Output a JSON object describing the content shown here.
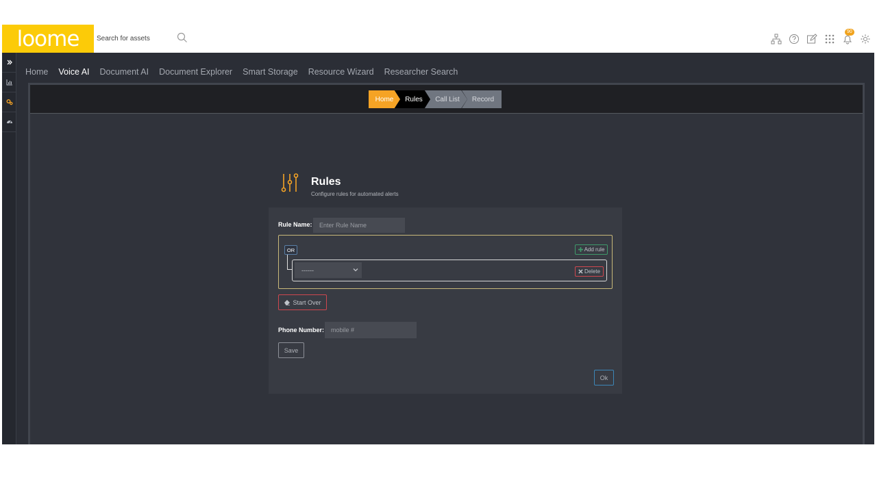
{
  "header": {
    "logo_text": "loome",
    "search_placeholder": "Search for assets",
    "notification_count": "90",
    "icons": [
      "sitemap-icon",
      "help-icon",
      "edit-icon",
      "apps-grid-icon",
      "bell-icon",
      "gear-icon"
    ]
  },
  "sidebar": {
    "items": [
      "expand-icon",
      "chart-icon",
      "cogs-icon",
      "dashboard-icon"
    ]
  },
  "nav": {
    "items": [
      "Home",
      "Voice AI",
      "Document AI",
      "Document Explorer",
      "Smart Storage",
      "Resource Wizard",
      "Researcher Search"
    ],
    "active": "Voice AI"
  },
  "breadcrumb": [
    "Home",
    "Rules",
    "Call List",
    "Record"
  ],
  "rules": {
    "title": "Rules",
    "subtitle": "Configure rules for automated alerts",
    "rule_name_label": "Rule Name:",
    "rule_name_placeholder": "Enter Rule Name",
    "or_label": "OR",
    "add_rule_label": "Add rule",
    "select_value": "------",
    "delete_label": "Delete",
    "start_over_label": "Start Over",
    "phone_label": "Phone Number:",
    "phone_placeholder": "mobile #",
    "save_label": "Save",
    "ok_label": "Ok"
  },
  "colors": {
    "brand": "#fccb08",
    "accent_orange": "#f5a325",
    "background": "#2b2e36"
  }
}
